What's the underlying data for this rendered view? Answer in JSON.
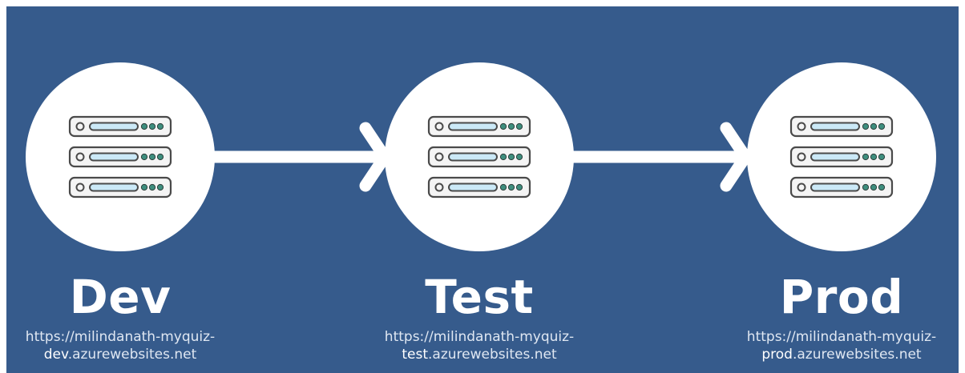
{
  "colors": {
    "background": "#365b8c",
    "circle": "#ffffff",
    "arrow": "#ffffff",
    "server_outline": "#4a4a4a",
    "server_screen": "#cbe9f7",
    "server_led": "#3e8e7e"
  },
  "icon": "server-rack-icon",
  "environments": [
    {
      "name": "Dev",
      "url_line1": "https://milindanath-myquiz-",
      "url_prefix": "dev",
      "url_suffix": ".azurewebsites.net"
    },
    {
      "name": "Test",
      "url_line1": "https://milindanath-myquiz-",
      "url_prefix": "test",
      "url_suffix": ".azurewebsites.net"
    },
    {
      "name": "Prod",
      "url_line1": "https://milindanath-myquiz-",
      "url_prefix": "prod",
      "url_suffix": ".azurewebsites.net"
    }
  ]
}
